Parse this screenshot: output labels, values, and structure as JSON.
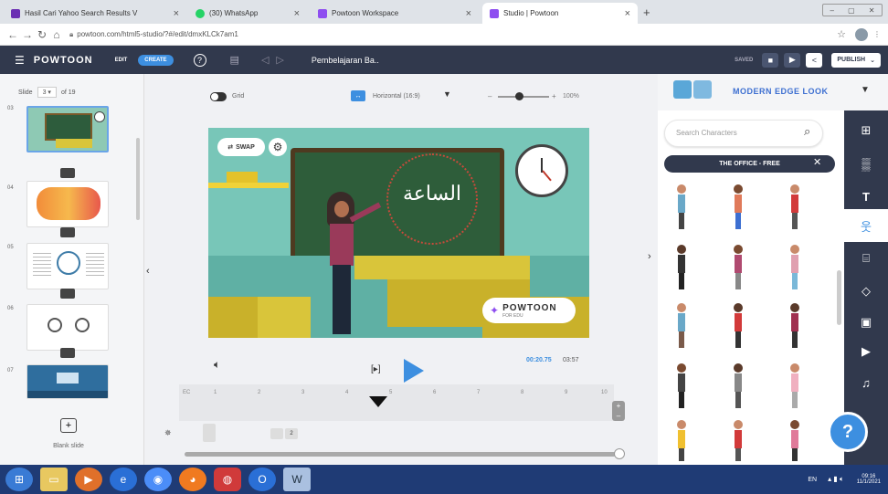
{
  "browser": {
    "tabs": [
      {
        "label": "Hasil Cari Yahoo Search Results V",
        "color": "#6b2fb3"
      },
      {
        "label": "(30) WhatsApp",
        "color": "#25d366"
      },
      {
        "label": "Powtoon Workspace",
        "color": "#8e4ef0"
      },
      {
        "label": "Studio | Powtoon",
        "color": "#8e4ef0"
      }
    ],
    "url": "powtoon.com/html5-studio/?#/edit/dmxKLCk7am1"
  },
  "toolbar": {
    "logo": "POWTOON",
    "edit": "EDIT",
    "create": "CREATE",
    "title": "Pembelajaran Ba..",
    "saved": "SAVED",
    "publish": "PUBLISH"
  },
  "slides": {
    "label": "Slide",
    "current": "3",
    "total": "of 19",
    "numbers": [
      "03",
      "04",
      "05",
      "06",
      "07"
    ],
    "blank": "Blank slide"
  },
  "stage": {
    "grid": "Grid",
    "orientation": "Horizontal (16:9)",
    "zoom": "100%",
    "swap": "SWAP",
    "arabic": "الساعة",
    "brand": "POWTOON",
    "brand_sub": "FOR EDU",
    "time_current": "00:20.75",
    "time_total": "03:57",
    "ruler_start": "EC",
    "ruler_ticks": [
      "1",
      "2",
      "3",
      "4",
      "5",
      "6",
      "7",
      "8",
      "9",
      "10"
    ],
    "layer_label": "2"
  },
  "right_panel": {
    "style": "MODERN EDGE LOOK",
    "search_placeholder": "Search Characters",
    "category": "THE OFFICE - FREE",
    "help": "?"
  },
  "taskbar": {
    "lang": "EN",
    "time": "09:16",
    "date": "11/1/2021"
  }
}
